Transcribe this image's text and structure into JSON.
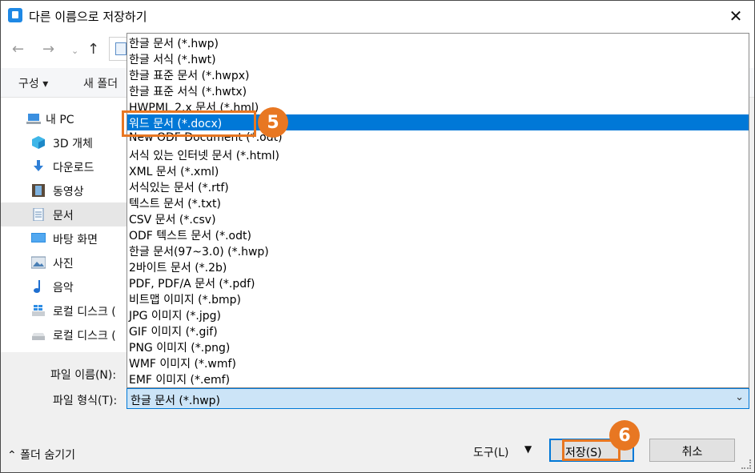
{
  "title": "다른 이름으로 저장하기",
  "toolbar": {
    "organize": "구성 ▾",
    "new_folder": "새 폴더"
  },
  "sidebar": {
    "items": [
      {
        "label": "내 PC",
        "icon": "computer-icon"
      },
      {
        "label": "3D 개체",
        "icon": "cube-icon"
      },
      {
        "label": "다운로드",
        "icon": "download-icon"
      },
      {
        "label": "동영상",
        "icon": "film-icon"
      },
      {
        "label": "문서",
        "icon": "document-icon"
      },
      {
        "label": "바탕 화면",
        "icon": "desktop-icon"
      },
      {
        "label": "사진",
        "icon": "picture-icon"
      },
      {
        "label": "음악",
        "icon": "music-icon"
      },
      {
        "label": "로컬 디스크 (",
        "icon": "windows-drive-icon"
      },
      {
        "label": "로컬 디스크 (",
        "icon": "drive-icon"
      }
    ],
    "selected_index": 4
  },
  "labels": {
    "filename": "파일 이름(N):",
    "filetype": "파일 형식(T):"
  },
  "filetype": {
    "value": "한글 문서 (*.hwp)"
  },
  "dropdown": {
    "options": [
      "한글 문서 (*.hwp)",
      "한글 서식 (*.hwt)",
      "한글 표준 문서 (*.hwpx)",
      "한글 표준 서식 (*.hwtx)",
      "HWPML 2.x 문서 (*.hml)",
      "워드 문서 (*.docx)",
      "New ODF Document (*.odt)",
      "서식 있는 인터넷 문서 (*.html)",
      "XML 문서 (*.xml)",
      "서식있는 문서 (*.rtf)",
      "텍스트 문서 (*.txt)",
      "CSV 문서 (*.csv)",
      "ODF 텍스트 문서 (*.odt)",
      "한글 문서(97~3.0) (*.hwp)",
      "2바이트 문서 (*.2b)",
      "PDF, PDF/A 문서 (*.pdf)",
      "비트맵 이미지 (*.bmp)",
      "JPG 이미지 (*.jpg)",
      "GIF 이미지 (*.gif)",
      "PNG 이미지 (*.png)",
      "WMF 이미지 (*.wmf)",
      "EMF 이미지 (*.emf)"
    ],
    "selected_index": 5
  },
  "footer": {
    "hide_folders": "⌃ 폴더 숨기기",
    "tools": "도구(L)",
    "save": "저장(S)",
    "cancel": "취소"
  },
  "annotations": {
    "step5": "5",
    "step6": "6"
  },
  "colors": {
    "accent": "#0078d7",
    "annotation": "#e87722",
    "selection_bg": "#0078d7"
  }
}
